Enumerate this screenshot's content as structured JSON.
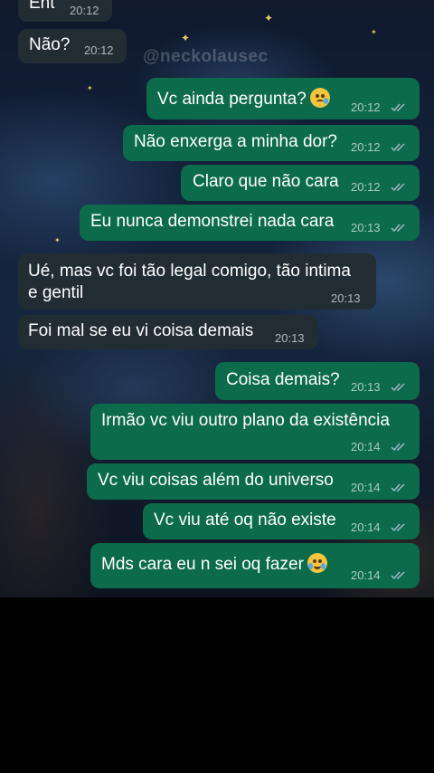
{
  "watermark": "@neckolausec",
  "messages": [
    {
      "dir": "in",
      "text": "Ent",
      "time": "20:12"
    },
    {
      "dir": "in",
      "text": "Não?",
      "time": "20:12"
    },
    {
      "dir": "out",
      "text": "Vc ainda pergunta?",
      "time": "20:12",
      "emoji": "face-holding-back-tears-emoji"
    },
    {
      "dir": "out",
      "text": "Não enxerga a minha dor?",
      "time": "20:12"
    },
    {
      "dir": "out",
      "text": "Claro que não cara",
      "time": "20:12"
    },
    {
      "dir": "out",
      "text": "Eu nunca demonstrei nada cara",
      "time": "20:13"
    },
    {
      "dir": "in",
      "text": "Ué, mas vc foi tão legal comigo, tão intima",
      "text2": "e gentil",
      "time": "20:13"
    },
    {
      "dir": "in",
      "text": "Foi mal se eu vi coisa demais",
      "time": "20:13"
    },
    {
      "dir": "out",
      "text": "Coisa demais?",
      "time": "20:13"
    },
    {
      "dir": "out",
      "text": "Irmão vc viu outro plano da existência",
      "time": "20:14"
    },
    {
      "dir": "out",
      "text": "Vc viu coisas além do universo",
      "time": "20:14"
    },
    {
      "dir": "out",
      "text": "Vc viu até oq não existe",
      "time": "20:14"
    },
    {
      "dir": "out",
      "text": "Mds cara eu n sei oq fazer",
      "time": "20:14",
      "emoji": "loudly-crying-face-emoji"
    }
  ],
  "colors": {
    "incoming_bubble": "#212c33",
    "outgoing_bubble": "#0c6b4b",
    "read_ticks": "#9fb8c4",
    "star": "#e8c96a"
  }
}
